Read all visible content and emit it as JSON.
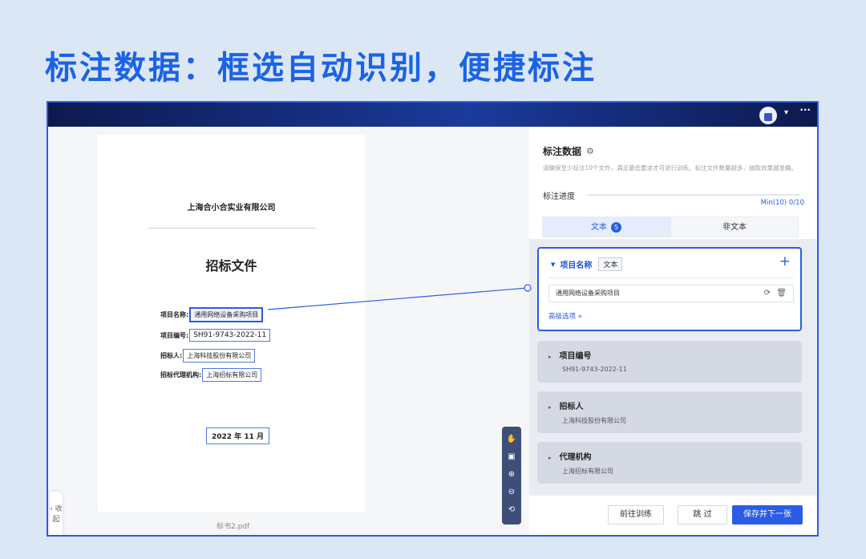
{
  "headline": "标注数据：框选自动识别，便捷标注",
  "topbar": {
    "dropdown_glyph": "▾",
    "more_glyph": "···"
  },
  "viewer": {
    "collapse_label": "‹ 收起",
    "document": {
      "company": "上海合小合实业有限公司",
      "title": "招标文件",
      "fields": [
        {
          "label": "项目名称:",
          "value": "通用网络设备采购项目"
        },
        {
          "label": "项目编号:",
          "value": "SH91-9743-2022-11"
        },
        {
          "label": "招标人:",
          "value": "上海科技股份有限公司"
        },
        {
          "label": "招标代理机构:",
          "value": "上海招标有限公司"
        }
      ],
      "date": "2022 年 11 月"
    },
    "filename": "标书2.pdf",
    "tools": [
      "hand-icon",
      "select-box-icon",
      "zoom-in-icon",
      "zoom-out-icon",
      "rotate-icon"
    ]
  },
  "panel": {
    "title": "标注数据",
    "description": "请确保至少标注10个文件，满足最低要求才可进行训练。标注文件数量越多，抽取效果越准确。",
    "progress_label": "标注进度",
    "progress_value": "Min(10)  0/10",
    "progress_fraction": 0,
    "tabs": [
      {
        "label": "文本",
        "badge": "5"
      },
      {
        "label": "非文本"
      }
    ],
    "active_card": {
      "title": "项目名称",
      "type_tag": "文本",
      "input_value": "通用网络设备采购项目",
      "advanced_label": "高级选项  »"
    },
    "cards": [
      {
        "title": "项目编号",
        "value": "SH91-9743-2022-11"
      },
      {
        "title": "招标人",
        "value": "上海科技股份有限公司"
      },
      {
        "title": "代理机构",
        "value": "上海招标有限公司"
      }
    ],
    "buttons": {
      "train": "前往训练",
      "skip": "跳 过",
      "save_next": "保存并下一张"
    }
  },
  "colors": {
    "accent": "#2a5ce6",
    "topbar": "#0d1a4d",
    "headline": "#1b63e6"
  }
}
